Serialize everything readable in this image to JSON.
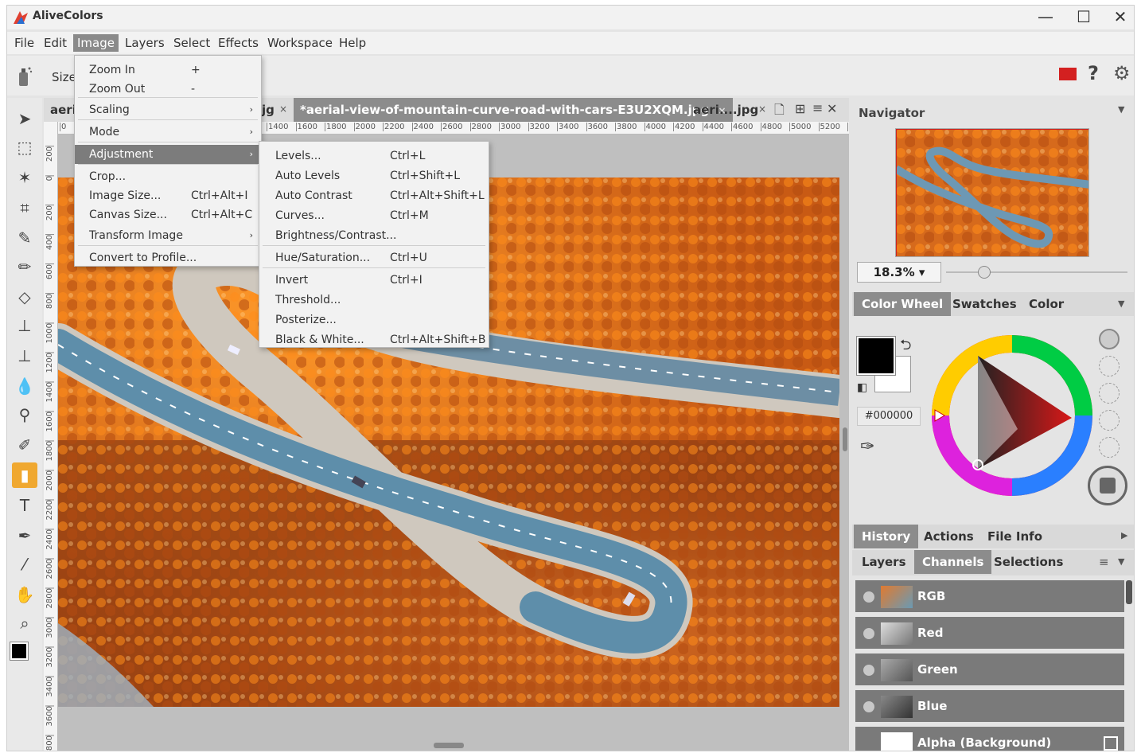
{
  "app": {
    "title": "AliveColors"
  },
  "menubar": [
    "File",
    "Edit",
    "Image",
    "Layers",
    "Select",
    "Effects",
    "Workspace",
    "Help"
  ],
  "options": {
    "size_label": "Size"
  },
  "tabs": {
    "left_partial": "aeri",
    "hidden_partial": "jg",
    "active": "*aerial-view-of-mountain-curve-road-with-cars-E3U2XQM.jpg",
    "other": "aeri....jpg",
    "close": "×"
  },
  "ruler": {
    "h_ticks": [
      "0",
      "1400",
      "1600",
      "1800",
      "2000",
      "2200",
      "2400",
      "2600",
      "2800",
      "3000",
      "3200",
      "3400",
      "3600",
      "3800",
      "4000",
      "4200",
      "4400",
      "4600",
      "4800",
      "5000",
      "5200",
      "54"
    ],
    "v_ticks": [
      "200",
      "0",
      "200",
      "400",
      "600",
      "800",
      "1000",
      "1200",
      "1400",
      "1600",
      "1800",
      "2000",
      "2200",
      "2400",
      "2600",
      "2800",
      "3000",
      "3200",
      "3400",
      "3600",
      "3800"
    ]
  },
  "image_menu": [
    {
      "label": "Zoom In",
      "shortcut": "+"
    },
    {
      "label": "Zoom Out",
      "shortcut": "-"
    },
    {
      "label": "Scaling",
      "submenu": true
    },
    {
      "label": "Mode",
      "submenu": true
    },
    {
      "label": "Adjustment",
      "submenu": true,
      "highlight": true
    },
    {
      "label": "Crop..."
    },
    {
      "label": "Image Size...",
      "shortcut": "Ctrl+Alt+I"
    },
    {
      "label": "Canvas Size...",
      "shortcut": "Ctrl+Alt+C"
    },
    {
      "label": "Transform Image",
      "submenu": true
    },
    {
      "label": "Convert to Profile..."
    }
  ],
  "adjustment_menu": [
    {
      "label": "Levels...",
      "shortcut": "Ctrl+L"
    },
    {
      "label": "Auto Levels",
      "shortcut": "Ctrl+Shift+L"
    },
    {
      "label": "Auto Contrast",
      "shortcut": "Ctrl+Alt+Shift+L"
    },
    {
      "label": "Curves...",
      "shortcut": "Ctrl+M"
    },
    {
      "label": "Brightness/Contrast...",
      "shortcut": ""
    },
    {
      "label": "Hue/Saturation...",
      "shortcut": "Ctrl+U"
    },
    {
      "label": "Invert",
      "shortcut": "Ctrl+I"
    },
    {
      "label": "Threshold...",
      "shortcut": ""
    },
    {
      "label": "Posterize...",
      "shortcut": ""
    },
    {
      "label": "Black & White...",
      "shortcut": "Ctrl+Alt+Shift+B"
    }
  ],
  "navigator": {
    "title": "Navigator",
    "zoom": "18.3%",
    "zoom_fraction": 0.22
  },
  "color_panel": {
    "tabs": [
      "Color Wheel",
      "Swatches",
      "Color"
    ],
    "hex": "#000000",
    "foreground": "#000000",
    "background": "#ffffff"
  },
  "history_tabs": [
    "History",
    "Actions",
    "File Info"
  ],
  "layer_tabs": [
    "Layers",
    "Channels",
    "Selections"
  ],
  "channels": [
    "RGB",
    "Red",
    "Green",
    "Blue",
    "Alpha (Background)"
  ],
  "colors": {
    "accent": "#f0a830",
    "menu_highlight": "#7c7c7c",
    "tab_active": "#8c8c8c",
    "close_red": "#d32020"
  }
}
